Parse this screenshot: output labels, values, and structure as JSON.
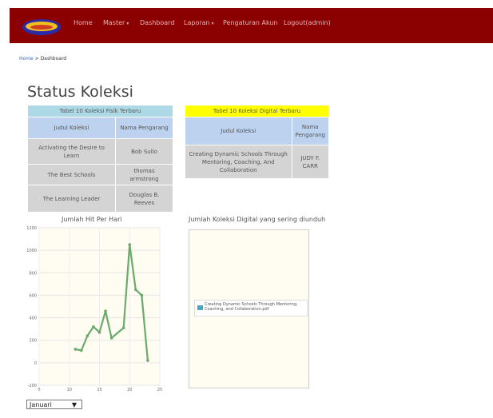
{
  "nav": {
    "items": [
      {
        "label": "Home",
        "has_caret": false
      },
      {
        "label": "Master",
        "has_caret": true
      },
      {
        "label": "Dashboard",
        "has_caret": false
      },
      {
        "label": "Laporan",
        "has_caret": true
      },
      {
        "label": "Pengaturan Akun",
        "has_caret": false
      },
      {
        "label": "Logout(admin)",
        "has_caret": false
      }
    ]
  },
  "breadcrumb": {
    "home": "Home",
    "separator": " > ",
    "current": "Dashboard"
  },
  "page_title": "Status Koleksi",
  "table_fisik": {
    "caption": "Tabel 10 Koleksi Fisik Terbaru",
    "headers": [
      "Judul Koleksi",
      "Nama Pengarang"
    ],
    "rows": [
      [
        "Activating the Desire to Learn",
        "Bob Sullo"
      ],
      [
        "The Best Schools",
        "thomas armstrong"
      ],
      [
        "The Learning Leader",
        "Douglas B. Reeves"
      ]
    ]
  },
  "table_digital": {
    "caption": "Tabel 10 Koleksi Digital Terbaru",
    "headers": [
      "Judul Koleksi",
      "Nama Pengarang"
    ],
    "rows": [
      [
        "Creating Dynamic Schools Through Mentoring, Coaching, And Collaboration",
        "JUDY F. CARR"
      ]
    ]
  },
  "chart_data": [
    {
      "type": "line",
      "title": "Jumlah Hit Per Hari",
      "xlabel": "",
      "ylabel": "",
      "x": [
        11,
        12,
        13,
        14,
        15,
        16,
        17,
        19,
        20,
        21,
        22,
        23
      ],
      "y": [
        120,
        110,
        240,
        320,
        270,
        460,
        220,
        310,
        1050,
        650,
        600,
        20
      ],
      "xlim": [
        5,
        25
      ],
      "ylim": [
        -200,
        1200
      ],
      "xticks": [
        5,
        10,
        15,
        20,
        25
      ],
      "yticks": [
        -200,
        0,
        200,
        400,
        600,
        800,
        1000,
        1200
      ],
      "grid": true,
      "color": "#6aaa6a"
    },
    {
      "type": "pie",
      "title": "Jumlah Koleksi Digital yang sering diunduh",
      "labels": [
        "Creating Dynamic Schools Through Mentoring, Coaching, and Collaboration.pdf"
      ],
      "values": [],
      "legend": "center",
      "colors": [
        "#4aa3c8"
      ]
    }
  ],
  "month_select": {
    "value": "Januari",
    "arrow": "▼"
  },
  "colors": {
    "navbar": "#8b0000",
    "nav_text": "#e8b4b4",
    "header_fisik": "#add8e6",
    "header_digital": "#ffff00"
  }
}
